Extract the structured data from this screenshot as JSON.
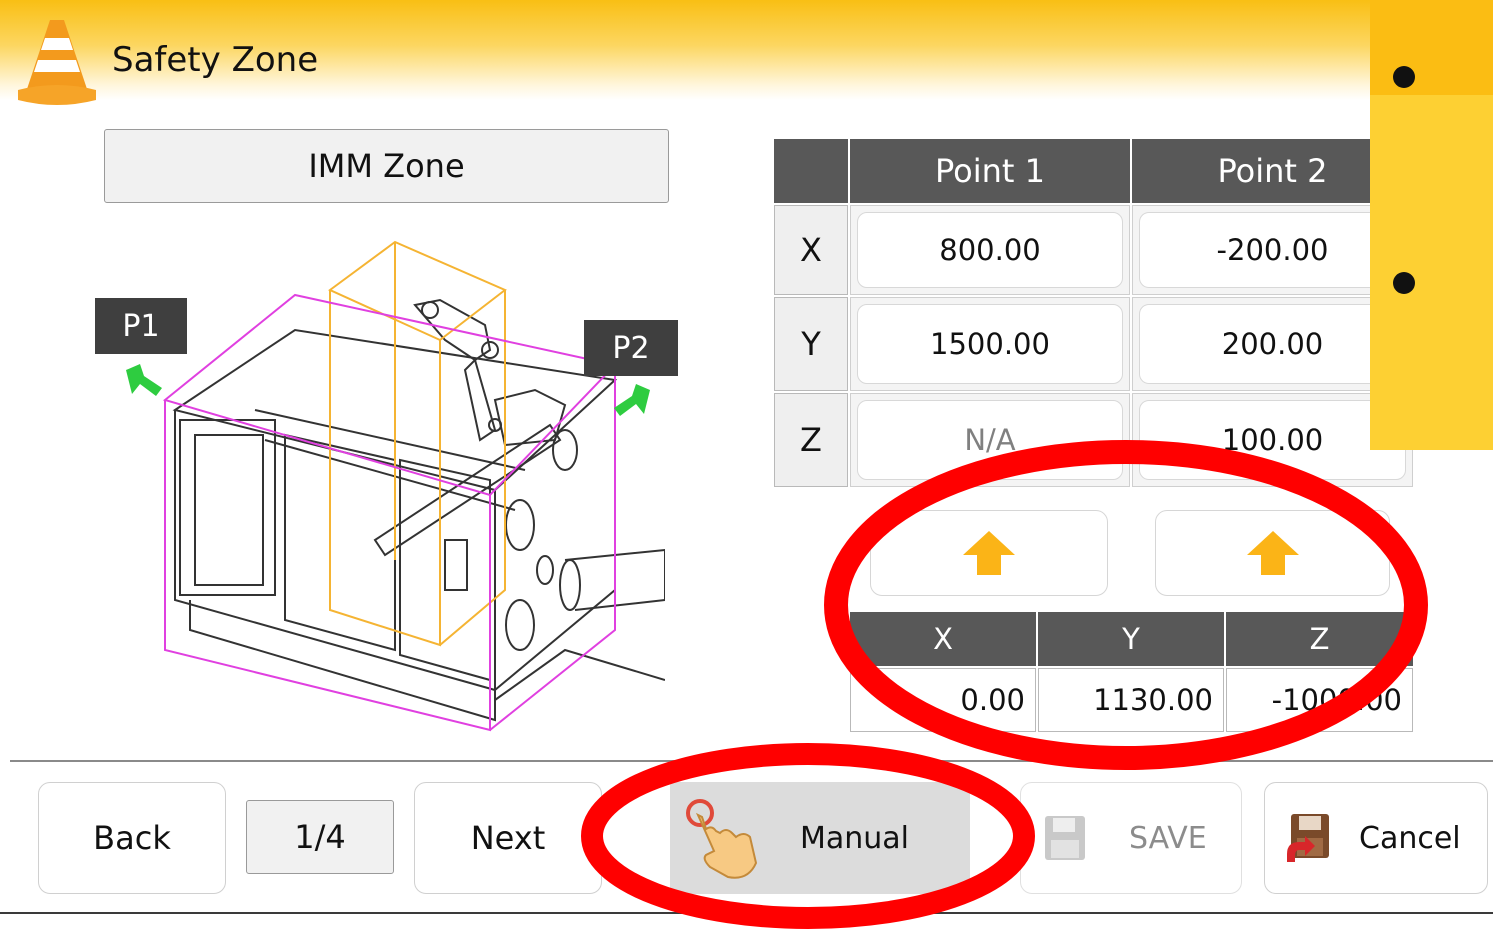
{
  "header": {
    "title": "Safety Zone",
    "icon": "traffic-cone-icon"
  },
  "zone": {
    "label": "IMM Zone"
  },
  "illustration": {
    "p1_label": "P1",
    "p2_label": "P2"
  },
  "points_table": {
    "headers": [
      "",
      "Point 1",
      "Point 2"
    ],
    "rows": [
      {
        "axis": "X",
        "p1": "800.00",
        "p2": "-200.00"
      },
      {
        "axis": "Y",
        "p1": "1500.00",
        "p2": "200.00"
      },
      {
        "axis": "Z",
        "p1": "N/A",
        "p2": "100.00"
      }
    ]
  },
  "current_position": {
    "headers": [
      "X",
      "Y",
      "Z"
    ],
    "values": [
      "0.00",
      "1130.00",
      "-1000.00"
    ]
  },
  "footer": {
    "back_label": "Back",
    "page_indicator": "1/4",
    "next_label": "Next",
    "manual_label": "Manual",
    "save_label": "SAVE",
    "cancel_label": "Cancel"
  },
  "colors": {
    "header_accent": "#f9bf14",
    "annotation_red": "#ff0000",
    "arrow_yellow": "#fbb417",
    "zone_magenta": "#e040e0",
    "zone_orange": "#f5b433"
  }
}
